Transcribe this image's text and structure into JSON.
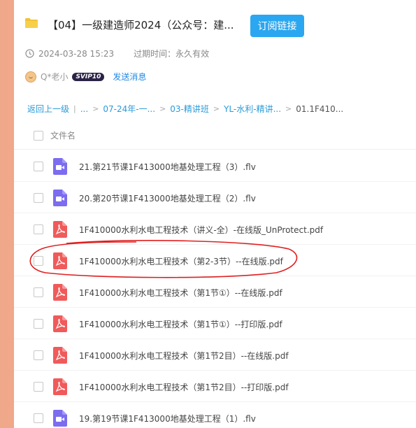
{
  "header": {
    "title": "【04】一级建造师2024（公众号：建...",
    "subscribe_label": "订阅链接",
    "date": "2024-03-28 15:23",
    "expire_label": "过期时间：永久有效",
    "username": "Q*老小",
    "badge": "SVIP10",
    "send_message": "发送消息"
  },
  "breadcrumb": {
    "back": "返回上一级",
    "sep": "|",
    "ellipsis": "...",
    "items": [
      "07-24年-一...",
      "03-精讲班",
      "YL-水利-精讲...",
      "01.1F410..."
    ],
    "arrow": ">"
  },
  "table": {
    "column_name": "文件名"
  },
  "files": [
    {
      "name": "21.第21节课1F413000地基处理工程（3）.flv",
      "type": "video"
    },
    {
      "name": "20.第20节课1F413000地基处理工程（2）.flv",
      "type": "video"
    },
    {
      "name": "1F410000水利水电工程技术（讲义-全）-在线版_UnProtect.pdf",
      "type": "pdf"
    },
    {
      "name": "1F410000水利水电工程技术（第2-3节）--在线版.pdf",
      "type": "pdf"
    },
    {
      "name": "1F410000水利水电工程技术（第1节①）--在线版.pdf",
      "type": "pdf"
    },
    {
      "name": "1F410000水利水电工程技术（第1节①）--打印版.pdf",
      "type": "pdf"
    },
    {
      "name": "1F410000水利水电工程技术（第1节2目）--在线版.pdf",
      "type": "pdf"
    },
    {
      "name": "1F410000水利水电工程技术（第1节2目）--打印版.pdf",
      "type": "pdf"
    },
    {
      "name": "19.第19节课1F413000地基处理工程（1）.flv",
      "type": "video"
    }
  ],
  "colors": {
    "accent": "#2aa7f0",
    "link": "#2a9bd8",
    "background": "#f0a88a",
    "video_icon": "#7b6cf0",
    "pdf_icon": "#f05a5a",
    "highlight_circle": "#e02020"
  },
  "icons": {
    "folder": "folder-icon",
    "clock": "clock-icon",
    "video": "video-file-icon",
    "pdf": "pdf-file-icon"
  }
}
